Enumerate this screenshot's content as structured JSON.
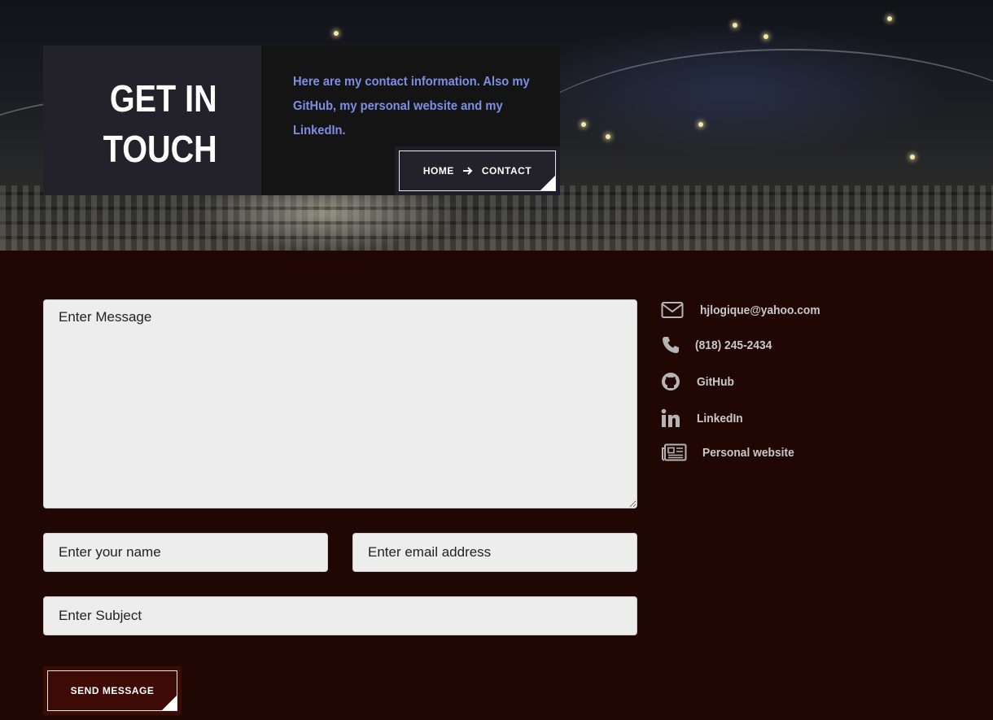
{
  "hero": {
    "title_line1": "GET IN",
    "title_line2": "TOUCH",
    "description": "Here are my contact information. Also my GitHub, my personal website and my LinkedIn.",
    "breadcrumb": {
      "home": "HOME",
      "current": "CONTACT"
    }
  },
  "form": {
    "message_placeholder": "Enter Message",
    "name_placeholder": "Enter your name",
    "email_placeholder": "Enter email address",
    "subject_placeholder": "Enter Subject",
    "submit_label": "SEND MESSAGE"
  },
  "contact": {
    "email": "hjlogique@yahoo.com",
    "phone": "(818) 245-2434",
    "github": "GitHub",
    "linkedin": "LinkedIn",
    "website": "Personal website"
  },
  "icons": [
    "envelope-icon",
    "phone-icon",
    "github-icon",
    "linkedin-icon",
    "newspaper-icon",
    "arrow-right-icon"
  ],
  "colors": {
    "page_background": "#200703",
    "accent_text": "#7d8ee6",
    "title_box": "#232129",
    "button": "#3d0a05"
  }
}
